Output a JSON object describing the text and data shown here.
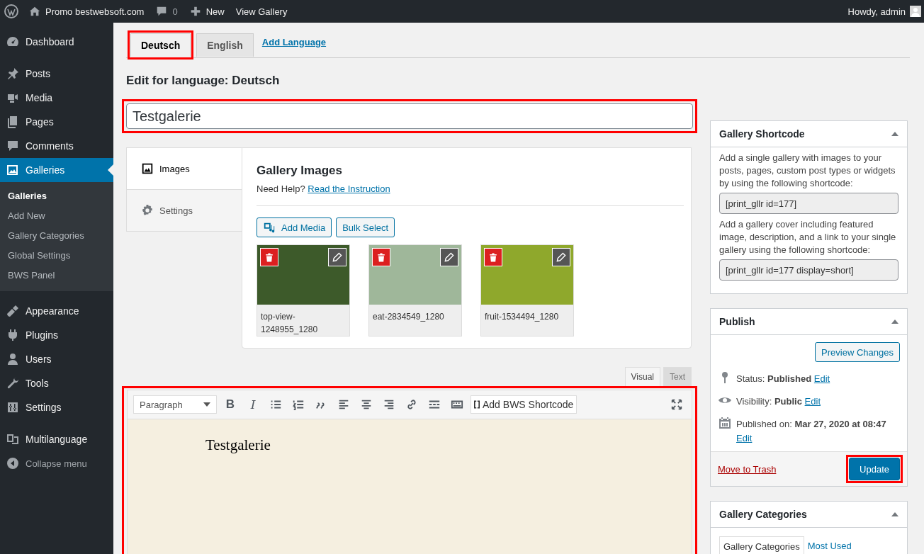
{
  "admin_bar": {
    "site": "Promo bestwebsoft.com",
    "comments": "0",
    "new": "New",
    "view": "View Gallery",
    "greeting": "Howdy, admin"
  },
  "sidebar": {
    "items": [
      {
        "label": "Dashboard",
        "selected": false
      },
      {
        "label": "Posts",
        "selected": false
      },
      {
        "label": "Media",
        "selected": false
      },
      {
        "label": "Pages",
        "selected": false
      },
      {
        "label": "Comments",
        "selected": false
      },
      {
        "label": "Galleries",
        "selected": true,
        "children": [
          {
            "label": "Galleries",
            "selected": true
          },
          {
            "label": "Add New",
            "selected": false
          },
          {
            "label": "Gallery Categories",
            "selected": false
          },
          {
            "label": "Global Settings",
            "selected": false
          },
          {
            "label": "BWS Panel",
            "selected": false
          }
        ]
      },
      {
        "label": "Appearance",
        "selected": false
      },
      {
        "label": "Plugins",
        "selected": false
      },
      {
        "label": "Users",
        "selected": false
      },
      {
        "label": "Tools",
        "selected": false
      },
      {
        "label": "Settings",
        "selected": false
      },
      {
        "label": "Multilanguage",
        "selected": false
      }
    ],
    "collapse": "Collapse menu"
  },
  "language_tabs": [
    {
      "label": "Deutsch",
      "selected": true,
      "highlighted": true
    },
    {
      "label": "English",
      "selected": false,
      "highlighted": false
    }
  ],
  "add_language": "Add Language",
  "heading": "Edit for language: Deutsch",
  "title_field": {
    "value": "Testgalerie",
    "highlighted": true
  },
  "gallery_box": {
    "tabs": [
      {
        "label": "Images",
        "selected": true
      },
      {
        "label": "Settings",
        "selected": false
      }
    ],
    "title": "Gallery Images",
    "help_prefix": "Need Help?",
    "help_link": "Read the Instruction",
    "add_media": "Add Media",
    "bulk_select": "Bulk Select",
    "images": [
      {
        "caption": "top-view-1248955_1280",
        "color": "#3d5a2a"
      },
      {
        "caption": "eat-2834549_1280",
        "color": "#9fb79a"
      },
      {
        "caption": "fruit-1534494_1280",
        "color": "#8fa82c"
      }
    ]
  },
  "editor": {
    "highlighted": true,
    "tabs": [
      {
        "label": "Visual",
        "selected": true
      },
      {
        "label": "Text",
        "selected": false
      }
    ],
    "format": "Paragraph",
    "bold": "B",
    "italic": "I",
    "shortcode_button": "Add BWS Shortcode",
    "content": "Testgalerie"
  },
  "shortcode_box": {
    "title": "Gallery Shortcode",
    "text_1": "Add a single gallery with images to your posts, pages, custom post types or widgets by using the following shortcode:",
    "code_1": "[print_gllr id=177]",
    "text_2": "Add a gallery cover including featured image, description, and a link to your single gallery using the following shortcode:",
    "code_2": "[print_gllr id=177 display=short]"
  },
  "publish_box": {
    "title": "Publish",
    "preview": "Preview Changes",
    "rows": [
      {
        "kind": "status",
        "text": "Status: **Published**",
        "link": "Edit"
      },
      {
        "kind": "visibility",
        "text": "Visibility: **Public**",
        "link": "Edit"
      },
      {
        "kind": "date",
        "text": "Published on: **Mar 27, 2020 at 08:47**",
        "link": "Edit"
      }
    ],
    "trash": "Move to Trash",
    "update": {
      "label": "Update",
      "highlighted": true
    }
  },
  "categories_box": {
    "title": "Gallery Categories",
    "tabs": [
      {
        "label": "Gallery Categories",
        "selected": true
      },
      {
        "label": "Most Used",
        "selected": false
      }
    ]
  }
}
